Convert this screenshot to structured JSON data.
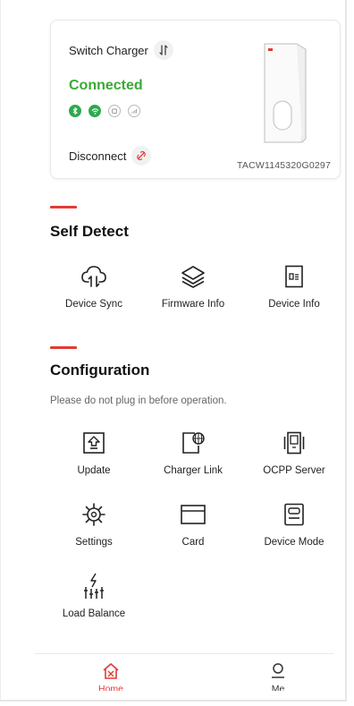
{
  "charger": {
    "switch_label": "Switch Charger",
    "status": "Connected",
    "disconnect_label": "Disconnect",
    "serial": "TACW1145320G0297",
    "connectivity": [
      {
        "name": "bluetooth",
        "state": "on"
      },
      {
        "name": "wifi",
        "state": "on"
      },
      {
        "name": "ethernet",
        "state": "off"
      },
      {
        "name": "cellular",
        "state": "off"
      }
    ]
  },
  "self_detect": {
    "title": "Self Detect",
    "items": [
      {
        "label": "Device Sync",
        "icon": "cloud-sync-icon"
      },
      {
        "label": "Firmware Info",
        "icon": "layers-icon"
      },
      {
        "label": "Device Info",
        "icon": "document-icon"
      }
    ]
  },
  "configuration": {
    "title": "Configuration",
    "note": "Please do not plug in before operation.",
    "items": [
      {
        "label": "Update",
        "icon": "upload-icon"
      },
      {
        "label": "Charger Link",
        "icon": "charger-link-icon"
      },
      {
        "label": "OCPP Server",
        "icon": "server-icon"
      },
      {
        "label": "Settings",
        "icon": "gear-icon"
      },
      {
        "label": "Card",
        "icon": "card-icon"
      },
      {
        "label": "Device Mode",
        "icon": "device-mode-icon"
      },
      {
        "label": "Load Balance",
        "icon": "load-balance-icon"
      }
    ]
  },
  "nav": {
    "home": "Home",
    "me": "Me"
  },
  "colors": {
    "accent": "#e53935",
    "connected": "#3aaa35"
  }
}
